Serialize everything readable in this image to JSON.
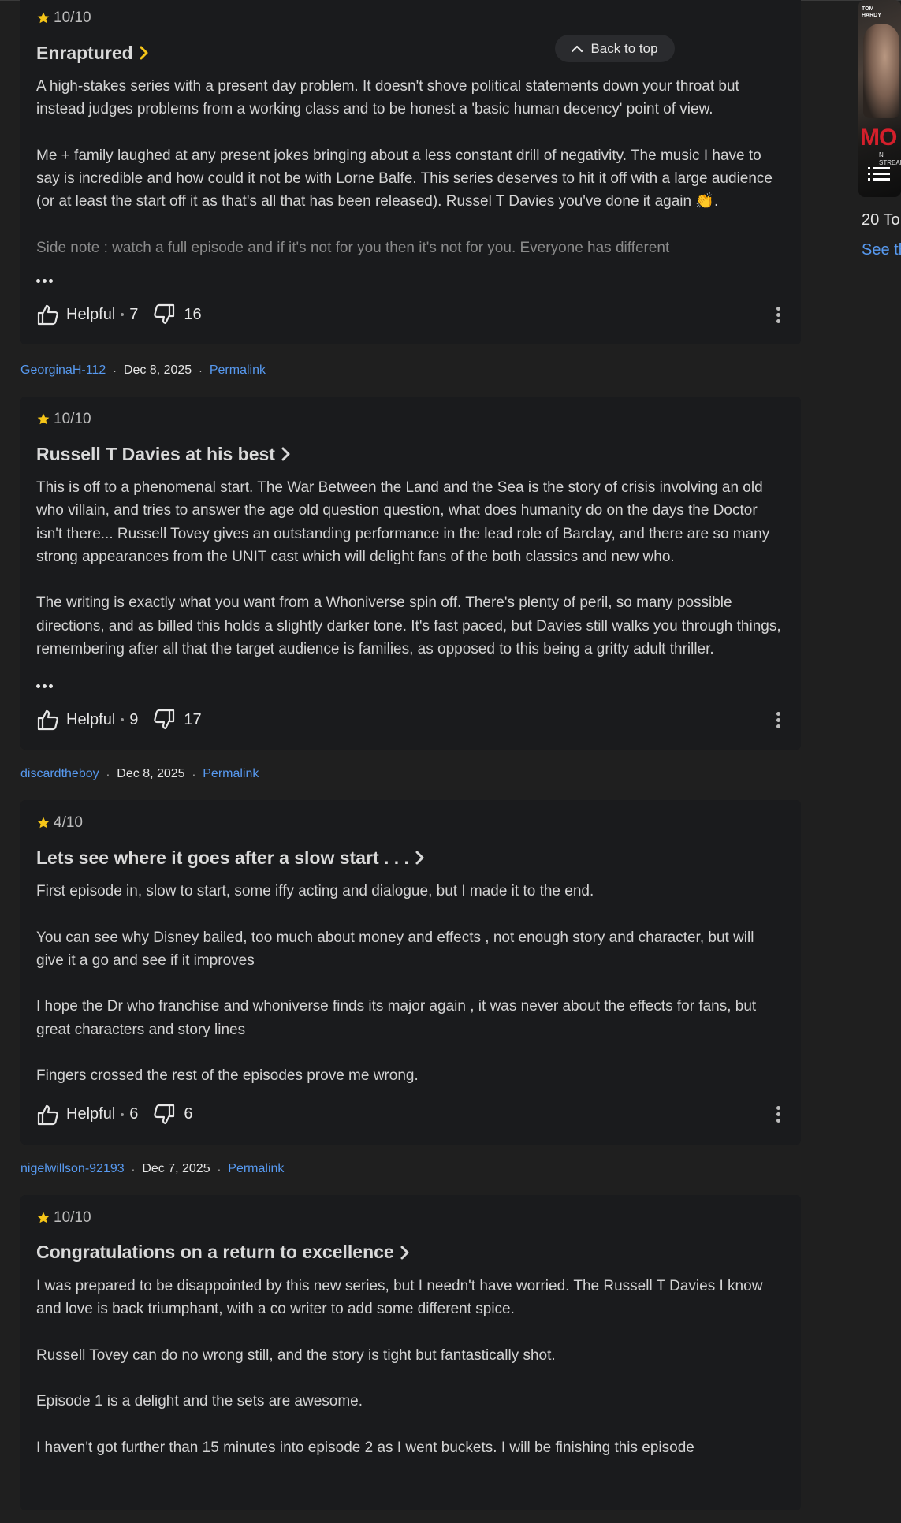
{
  "back_to_top": {
    "label": "Back to top"
  },
  "sidebar": {
    "poster": {
      "name_line": "TOM\nHARDY",
      "brand": "MO",
      "sub": "N\nSTREAM"
    },
    "list_title": "20 To",
    "see_link": "See th"
  },
  "reviews": [
    {
      "rating": "10/10",
      "title": "Enraptured",
      "paragraphs": [
        "A high-stakes series with a present day problem. It doesn't shove political statements down your throat but instead judges problems from a working class and to be honest a 'basic human decency' point of view.",
        "Me + family laughed at any present jokes bringing about a less constant drill of negativity. The music I have to say is incredible and how could it not be with Lorne Balfe. This series deserves to hit it off with a large audience (or at least the start off it as that's all that has been released). Russel T Davies you've done it again 👏.",
        "Side note : watch a full episode and if it's not for you then it's not for you. Everyone has different"
      ],
      "helpful_label": "Helpful",
      "helpful_count": "7",
      "not_helpful_count": "16",
      "author": "GeorginaH-112",
      "date": "Dec 8, 2025",
      "permalink": "Permalink"
    },
    {
      "rating": "10/10",
      "title": "Russell T Davies at his best",
      "paragraphs": [
        "This is off to a phenomenal start. The War Between the Land and the Sea is the story of crisis involving an old who villain, and tries to answer the age old question question, what does humanity do on the days the Doctor isn't there... Russell Tovey gives an outstanding performance in the lead role of Barclay, and there are so many strong appearances from the UNIT cast which will delight fans of the both classics and new who.",
        "The writing is exactly what you want from a Whoniverse spin off. There's plenty of peril, so many possible directions, and as billed this holds a slightly darker tone. It's fast paced, but Davies still walks you through things, remembering after all that the target audience is families, as opposed to this being a gritty adult thriller."
      ],
      "helpful_label": "Helpful",
      "helpful_count": "9",
      "not_helpful_count": "17",
      "author": "discardtheboy",
      "date": "Dec 8, 2025",
      "permalink": "Permalink"
    },
    {
      "rating": "4/10",
      "title": "Lets see where it goes after a slow start . . .",
      "paragraphs": [
        "First episode in, slow to start, some iffy acting and dialogue, but I made it to the end.",
        "You can see why Disney bailed, too much about money and effects , not enough story and character, but will give it a go and see if it improves",
        "I hope the Dr who franchise and whoniverse finds its major again , it was never about the effects for fans, but great characters and story lines",
        "Fingers crossed the rest of the episodes prove me wrong."
      ],
      "helpful_label": "Helpful",
      "helpful_count": "6",
      "not_helpful_count": "6",
      "author": "nigelwillson-92193",
      "date": "Dec 7, 2025",
      "permalink": "Permalink"
    },
    {
      "rating": "10/10",
      "title": "Congratulations on a return to excellence",
      "paragraphs": [
        "I was prepared to be disappointed by this new series, but I needn't have worried. The Russell T Davies I know and love is back triumphant, with a co writer to add some different spice.",
        "Russell Tovey can do no wrong still, and the story is tight but fantastically shot.",
        "Episode 1 is a delight and the sets are awesome.",
        "I haven't got further than 15 minutes into episode 2 as I went buckets. I will be finishing this episode"
      ]
    }
  ],
  "colors": {
    "background": "#1f1f1f",
    "card": "#1a1b1d",
    "star": "#f5c518",
    "link": "#5799ef"
  }
}
